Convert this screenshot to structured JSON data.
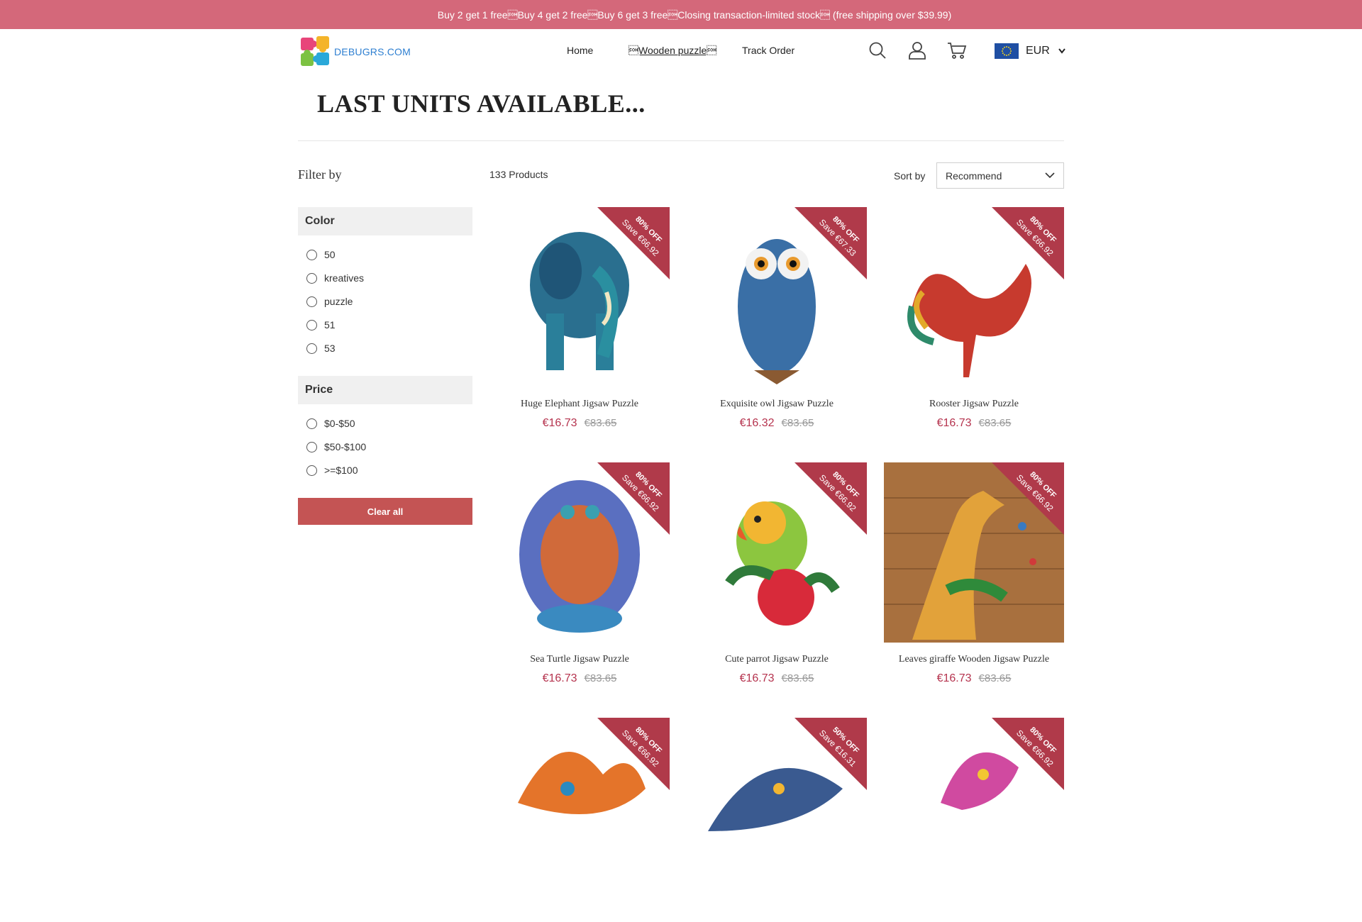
{
  "announcement": "Buy 2 get 1 free\u0001Buy 4 get 2 free\u0001Buy 6 get 3 free\u0001Closing transaction-limited stock\u0001 (free shipping over $39.99)",
  "brand": {
    "logo_text": "DEBUGRS.COM"
  },
  "nav": [
    {
      "label": "Home"
    },
    {
      "label": "\u0001Wooden puzzle\u0001"
    },
    {
      "label": "Track Order"
    }
  ],
  "header_icons": [
    "search-icon",
    "account-icon",
    "cart-icon"
  ],
  "currency": {
    "code": "EUR"
  },
  "page_title": "LAST UNITS AVAILABLE...",
  "filters": {
    "title": "Filter by",
    "color": {
      "label": "Color",
      "options": [
        "50",
        "kreatives",
        "puzzle",
        "51",
        "53"
      ]
    },
    "price": {
      "label": "Price",
      "options": [
        "$0-$50",
        "$50-$100",
        ">=$100"
      ]
    },
    "clear_label": "Clear all"
  },
  "listing": {
    "count_label": "133 Products",
    "sort_label": "Sort by",
    "sort_value": "Recommend"
  },
  "products": [
    {
      "name": "Huge Elephant Jigsaw Puzzle",
      "price": "€16.73",
      "compare": "€83.65",
      "badge_off": "80% OFF",
      "badge_save": "Save €66.92"
    },
    {
      "name": "Exquisite owl Jigsaw Puzzle",
      "price": "€16.32",
      "compare": "€83.65",
      "badge_off": "80% OFF",
      "badge_save": "Save €67.33"
    },
    {
      "name": "Rooster Jigsaw Puzzle",
      "price": "€16.73",
      "compare": "€83.65",
      "badge_off": "80% OFF",
      "badge_save": "Save €66.92"
    },
    {
      "name": "Sea Turtle Jigsaw Puzzle",
      "price": "€16.73",
      "compare": "€83.65",
      "badge_off": "80% OFF",
      "badge_save": "Save €66.92"
    },
    {
      "name": "Cute parrot Jigsaw Puzzle",
      "price": "€16.73",
      "compare": "€83.65",
      "badge_off": "80% OFF",
      "badge_save": "Save €66.92"
    },
    {
      "name": "Leaves giraffe Wooden Jigsaw Puzzle",
      "price": "€16.73",
      "compare": "€83.65",
      "badge_off": "80% OFF",
      "badge_save": "Save €66.92"
    },
    {
      "name": "",
      "price": "",
      "compare": "",
      "badge_off": "80% OFF",
      "badge_save": "Save €66.92"
    },
    {
      "name": "",
      "price": "",
      "compare": "",
      "badge_off": "50% OFF",
      "badge_save": "Save €16.31"
    },
    {
      "name": "",
      "price": "",
      "compare": "",
      "badge_off": "80% OFF",
      "badge_save": "Save €66.92"
    }
  ],
  "colors": {
    "announcement_bg": "#d4687a",
    "badge": "#b03a4a",
    "price": "#b5334e",
    "clear_button": "#c45454"
  }
}
